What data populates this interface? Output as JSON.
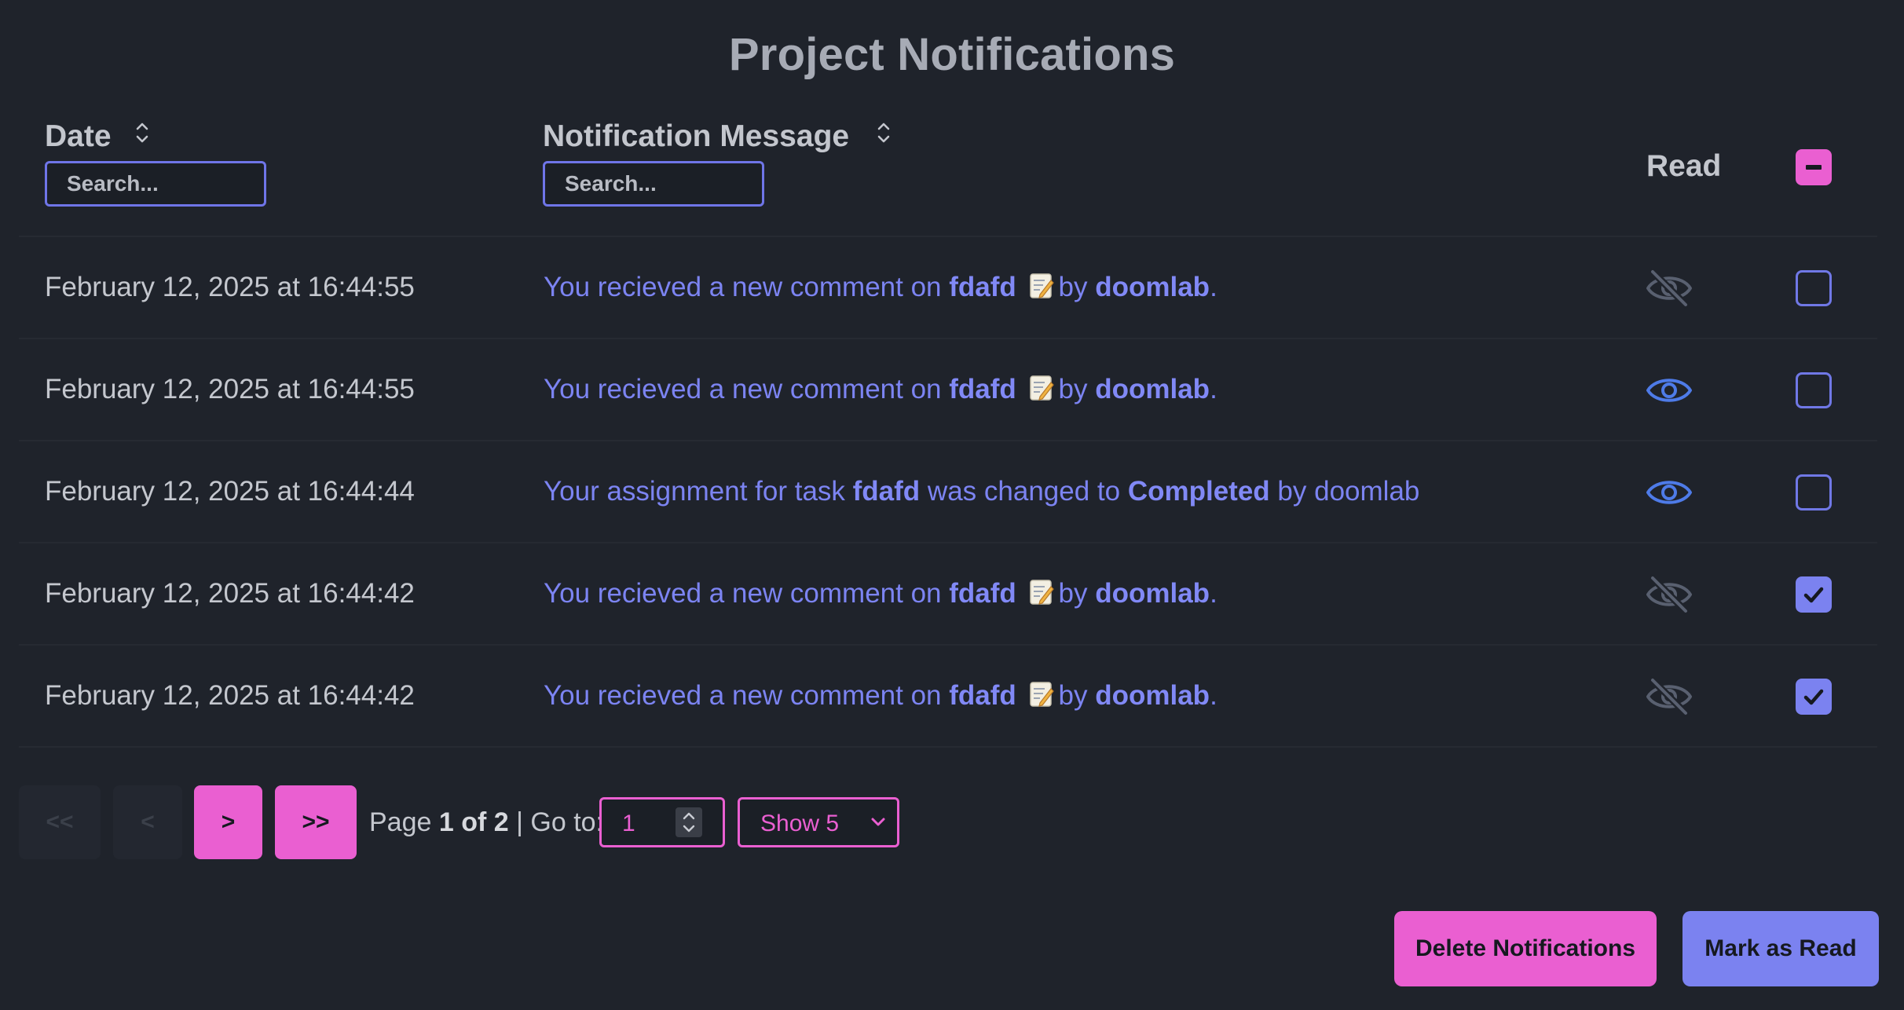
{
  "title": "Project Notifications",
  "columns": {
    "date": "Date",
    "message": "Notification Message",
    "read": "Read"
  },
  "search": {
    "date_placeholder": "Search...",
    "message_placeholder": "Search..."
  },
  "select_all_state": "indeterminate",
  "rows": [
    {
      "date": "February 12, 2025 at 16:44:55",
      "type": "comment",
      "msg_1": "You recieved a new comment on",
      "task": "fdafd",
      "msg_2": "by",
      "user": "doomlab",
      "msg_3": ".",
      "read": false,
      "selected": false
    },
    {
      "date": "February 12, 2025 at 16:44:55",
      "type": "comment",
      "msg_1": "You recieved a new comment on",
      "task": "fdafd",
      "msg_2": "by",
      "user": "doomlab",
      "msg_3": ".",
      "read": true,
      "selected": false
    },
    {
      "date": "February 12, 2025 at 16:44:44",
      "type": "assignment",
      "msg_1": "Your assignment for task",
      "task": "fdafd",
      "msg_2": "was changed to",
      "status": "Completed",
      "msg_3": "by doomlab",
      "read": true,
      "selected": false
    },
    {
      "date": "February 12, 2025 at 16:44:42",
      "type": "comment",
      "msg_1": "You recieved a new comment on",
      "task": "fdafd",
      "msg_2": "by",
      "user": "doomlab",
      "msg_3": ".",
      "read": false,
      "selected": true
    },
    {
      "date": "February 12, 2025 at 16:44:42",
      "type": "comment",
      "msg_1": "You recieved a new comment on",
      "task": "fdafd",
      "msg_2": "by",
      "user": "doomlab",
      "msg_3": ".",
      "read": false,
      "selected": true
    }
  ],
  "pagination": {
    "first": "<<",
    "prev": "<",
    "next": ">",
    "last": ">>",
    "page_word": "Page",
    "current_of_total": "1 of 2",
    "goto_label": "| Go to:",
    "goto_value": "1",
    "show_label": "Show 5"
  },
  "actions": {
    "delete": "Delete Notifications",
    "mark_read": "Mark as Read"
  },
  "colors": {
    "background": "#1f232b",
    "accent_pink": "#ea5fd1",
    "accent_indigo": "#7b82f0",
    "link": "#7c84f2",
    "eye_read": "#4e7be8",
    "eye_unread": "#596070"
  },
  "icons": {
    "sort": "sort-icon",
    "read": "eye-icon",
    "unread": "eye-slash-icon",
    "memo": "memo-icon",
    "check": "check-icon",
    "minus": "minus-icon",
    "chevron": "chevron-down-icon"
  }
}
